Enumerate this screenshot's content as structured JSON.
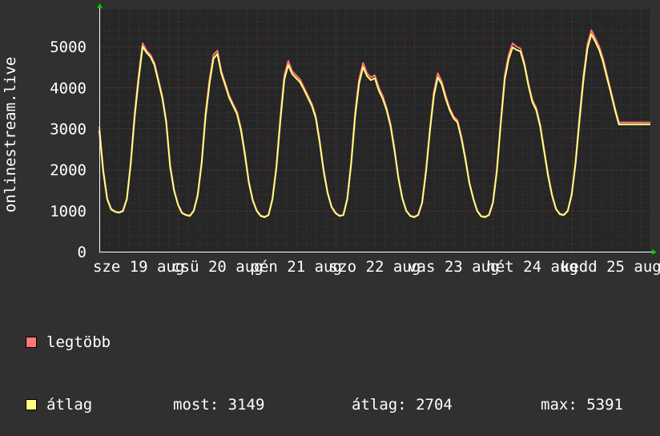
{
  "chart_data": {
    "type": "line",
    "ylabel": "onlinestream.live",
    "ylim": [
      0,
      5900
    ],
    "yticks": [
      0,
      1000,
      2000,
      3000,
      4000,
      5000
    ],
    "ytick_labels": [
      "0",
      "1000",
      "2000",
      "3000",
      "4000",
      "5000"
    ],
    "xlim": [
      0,
      7
    ],
    "xtick_labels": [
      {
        "x": 0.0,
        "label": "sze 19 aug"
      },
      {
        "x": 1.0,
        "label": "csü 20 aug"
      },
      {
        "x": 2.0,
        "label": "pén 21 aug"
      },
      {
        "x": 3.0,
        "label": "szo 22 aug"
      },
      {
        "x": 4.0,
        "label": "vas 23 aug"
      },
      {
        "x": 5.0,
        "label": "hét 24 aug"
      },
      {
        "x": 6.0,
        "label": "kedd 25 aug"
      }
    ],
    "grid": true,
    "series": [
      {
        "name": "legtöbb",
        "color": "#ff7777",
        "x": [
          0.0,
          0.05,
          0.1,
          0.15,
          0.2,
          0.25,
          0.3,
          0.35,
          0.4,
          0.45,
          0.5,
          0.55,
          0.6,
          0.65,
          0.7,
          0.75,
          0.8,
          0.85,
          0.9,
          0.95,
          1.0,
          1.05,
          1.1,
          1.15,
          1.2,
          1.25,
          1.3,
          1.35,
          1.4,
          1.45,
          1.5,
          1.55,
          1.6,
          1.65,
          1.7,
          1.75,
          1.8,
          1.85,
          1.9,
          1.95,
          2.0,
          2.05,
          2.1,
          2.15,
          2.2,
          2.25,
          2.3,
          2.35,
          2.4,
          2.45,
          2.5,
          2.55,
          2.6,
          2.65,
          2.7,
          2.75,
          2.8,
          2.85,
          2.9,
          2.95,
          3.0,
          3.05,
          3.1,
          3.15,
          3.2,
          3.25,
          3.3,
          3.35,
          3.4,
          3.45,
          3.5,
          3.55,
          3.6,
          3.65,
          3.7,
          3.75,
          3.8,
          3.85,
          3.9,
          3.95,
          4.0,
          4.05,
          4.1,
          4.15,
          4.2,
          4.25,
          4.3,
          4.35,
          4.4,
          4.45,
          4.5,
          4.55,
          4.6,
          4.65,
          4.7,
          4.75,
          4.8,
          4.85,
          4.9,
          4.95,
          5.0,
          5.05,
          5.1,
          5.15,
          5.2,
          5.25,
          5.3,
          5.35,
          5.4,
          5.45,
          5.5,
          5.55,
          5.6,
          5.65,
          5.7,
          5.75,
          5.8,
          5.85,
          5.9,
          5.95,
          6.0,
          6.05,
          6.1,
          6.15,
          6.2,
          6.25,
          6.3,
          6.35,
          6.4,
          6.45,
          6.5,
          6.55,
          6.6,
          6.65,
          6.7,
          6.75,
          6.8,
          6.85,
          6.9,
          6.95,
          7.0
        ],
        "values": [
          3050,
          2000,
          1300,
          1050,
          980,
          960,
          1000,
          1300,
          2200,
          3400,
          4300,
          5080,
          4900,
          4800,
          4600,
          4200,
          3800,
          3200,
          2100,
          1500,
          1150,
          950,
          900,
          880,
          1000,
          1400,
          2200,
          3400,
          4200,
          4800,
          4900,
          4400,
          4100,
          3800,
          3600,
          3400,
          3000,
          2400,
          1700,
          1250,
          1000,
          880,
          850,
          900,
          1300,
          2100,
          3300,
          4300,
          4650,
          4400,
          4300,
          4200,
          4000,
          3800,
          3600,
          3300,
          2700,
          2000,
          1450,
          1100,
          950,
          880,
          900,
          1300,
          2200,
          3400,
          4200,
          4600,
          4350,
          4250,
          4300,
          4000,
          3800,
          3500,
          3100,
          2500,
          1800,
          1300,
          1000,
          880,
          850,
          900,
          1200,
          2000,
          3000,
          3900,
          4350,
          4150,
          3800,
          3500,
          3300,
          3200,
          2800,
          2300,
          1700,
          1300,
          1000,
          870,
          850,
          900,
          1200,
          2000,
          3200,
          4300,
          4800,
          5080,
          5000,
          4950,
          4600,
          4100,
          3700,
          3500,
          3100,
          2500,
          1900,
          1400,
          1050,
          920,
          900,
          1000,
          1400,
          2200,
          3300,
          4300,
          5050,
          5400,
          5200,
          5000,
          4700,
          4300,
          3900,
          3500,
          3149,
          3149,
          3149,
          3149,
          3149,
          3149,
          3149,
          3149,
          3149
        ]
      },
      {
        "name": "átlag",
        "color": "#ffff80",
        "x": [
          0.0,
          0.05,
          0.1,
          0.15,
          0.2,
          0.25,
          0.3,
          0.35,
          0.4,
          0.45,
          0.5,
          0.55,
          0.6,
          0.65,
          0.7,
          0.75,
          0.8,
          0.85,
          0.9,
          0.95,
          1.0,
          1.05,
          1.1,
          1.15,
          1.2,
          1.25,
          1.3,
          1.35,
          1.4,
          1.45,
          1.5,
          1.55,
          1.6,
          1.65,
          1.7,
          1.75,
          1.8,
          1.85,
          1.9,
          1.95,
          2.0,
          2.05,
          2.1,
          2.15,
          2.2,
          2.25,
          2.3,
          2.35,
          2.4,
          2.45,
          2.5,
          2.55,
          2.6,
          2.65,
          2.7,
          2.75,
          2.8,
          2.85,
          2.9,
          2.95,
          3.0,
          3.05,
          3.1,
          3.15,
          3.2,
          3.25,
          3.3,
          3.35,
          3.4,
          3.45,
          3.5,
          3.55,
          3.6,
          3.65,
          3.7,
          3.75,
          3.8,
          3.85,
          3.9,
          3.95,
          4.0,
          4.05,
          4.1,
          4.15,
          4.2,
          4.25,
          4.3,
          4.35,
          4.4,
          4.45,
          4.5,
          4.55,
          4.6,
          4.65,
          4.7,
          4.75,
          4.8,
          4.85,
          4.9,
          4.95,
          5.0,
          5.05,
          5.1,
          5.15,
          5.2,
          5.25,
          5.3,
          5.35,
          5.4,
          5.45,
          5.5,
          5.55,
          5.6,
          5.65,
          5.7,
          5.75,
          5.8,
          5.85,
          5.9,
          5.95,
          6.0,
          6.05,
          6.1,
          6.15,
          6.2,
          6.25,
          6.3,
          6.35,
          6.4,
          6.45,
          6.5,
          6.55,
          6.6,
          6.65,
          6.7,
          6.75,
          6.8,
          6.85,
          6.9,
          6.95,
          7.0
        ],
        "values": [
          2950,
          1950,
          1280,
          1030,
          970,
          950,
          990,
          1280,
          2150,
          3300,
          4200,
          5000,
          4850,
          4750,
          4550,
          4150,
          3750,
          3150,
          2050,
          1480,
          1140,
          940,
          890,
          870,
          990,
          1380,
          2150,
          3300,
          4100,
          4700,
          4820,
          4350,
          4050,
          3750,
          3550,
          3350,
          2950,
          2350,
          1680,
          1240,
          990,
          870,
          840,
          890,
          1280,
          2050,
          3200,
          4200,
          4550,
          4330,
          4230,
          4130,
          3950,
          3750,
          3550,
          3250,
          2650,
          1950,
          1430,
          1090,
          940,
          870,
          890,
          1280,
          2150,
          3300,
          4100,
          4500,
          4280,
          4180,
          4230,
          3930,
          3730,
          3450,
          3050,
          2450,
          1780,
          1290,
          990,
          870,
          840,
          890,
          1190,
          1950,
          2950,
          3800,
          4250,
          4080,
          3730,
          3450,
          3250,
          3150,
          2750,
          2250,
          1680,
          1290,
          990,
          860,
          840,
          890,
          1190,
          1950,
          3150,
          4200,
          4700,
          4980,
          4920,
          4880,
          4550,
          4050,
          3650,
          3450,
          3050,
          2450,
          1850,
          1380,
          1040,
          910,
          890,
          990,
          1380,
          2150,
          3200,
          4200,
          4950,
          5300,
          5120,
          4920,
          4620,
          4230,
          3850,
          3450,
          3100,
          3100,
          3100,
          3100,
          3100,
          3100,
          3100,
          3100,
          3100
        ]
      }
    ]
  },
  "legend": {
    "items": [
      {
        "label": "legtöbb",
        "color": "#ff7777"
      },
      {
        "label": "átlag",
        "color": "#ffff80"
      }
    ],
    "stats": {
      "most": "most: 3149",
      "atlag": "átlag: 2704",
      "max": "max: 5391"
    }
  },
  "colors": {
    "background": "#303030",
    "plot_background": "#262626",
    "grid_major": "#5a2a2a",
    "grid_minor": "#3a3a3a",
    "axis": "#ffffff",
    "text": "#ffffff"
  }
}
